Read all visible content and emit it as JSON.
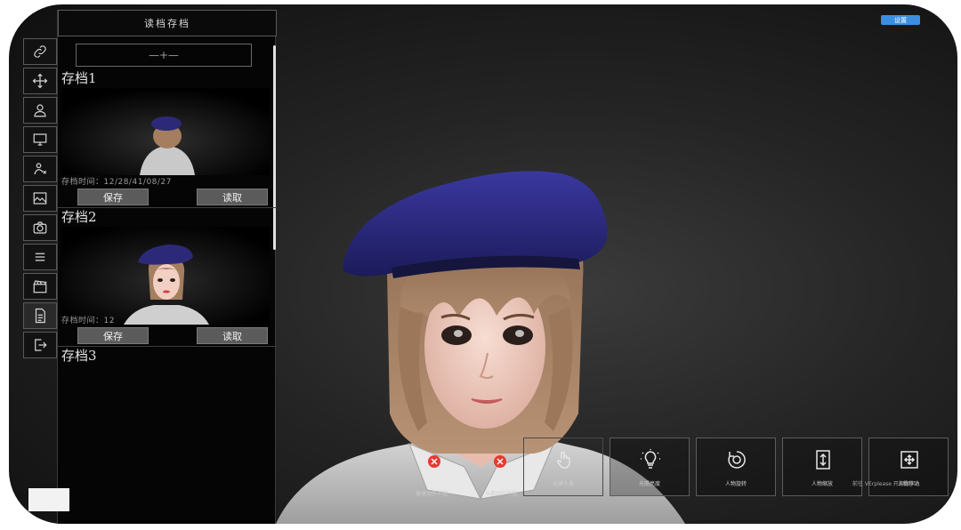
{
  "panel": {
    "title": "读档存档",
    "page_field": "—+—",
    "slots": [
      {
        "label": "存档1",
        "timestamp": "存档时间：12/28/41/08/27",
        "save_label": "保存",
        "load_label": "读取"
      },
      {
        "label": "存档2",
        "timestamp": "存档时间：12",
        "save_label": "保存",
        "load_label": "读取"
      },
      {
        "label": "存档3"
      }
    ]
  },
  "toolbar": {
    "icons": [
      "link-icon",
      "move-icon",
      "user-icon",
      "monitor-icon",
      "pose-icon",
      "image-icon",
      "camera-icon",
      "list-icon",
      "clapper-icon",
      "document-icon",
      "exit-icon"
    ]
  },
  "colors": {
    "beret": "#2c2a78",
    "hair": "#a47e5e",
    "skin": "#f1cfc3",
    "shirt": "#cfcfcf",
    "delete_marker": "#e53a32",
    "badge": "#3c8fe0"
  },
  "actions": [
    {
      "name": "hand",
      "icon": "hand-pointer-icon",
      "label": "抚摸头发"
    },
    {
      "name": "light",
      "icon": "bulb-icon",
      "label": "光照亮度"
    },
    {
      "name": "rotate",
      "icon": "rotate-icon",
      "label": "人物旋转"
    },
    {
      "name": "scale",
      "icon": "vertical-arrows-icon",
      "label": "人物缩放"
    },
    {
      "name": "move",
      "icon": "move-cross-icon",
      "label": "人物移动"
    }
  ],
  "shirt_buttons": [
    {
      "label": "身体动作不限"
    },
    {
      "label": "头部动作不限"
    }
  ],
  "watermark": "前往 VErplease 开源数字人",
  "badge": "设置"
}
